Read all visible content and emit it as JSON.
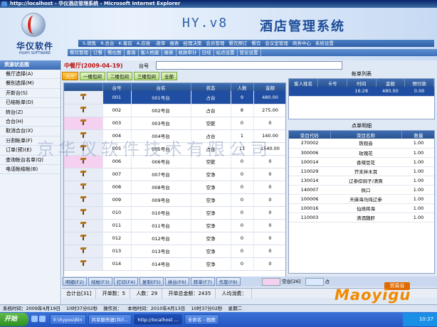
{
  "window_title": "http://localhost - 华仪酒店管理系统 - Microsoft Internet Explorer",
  "header": {
    "logo_cn": "华仪软件",
    "logo_en": "HUAYI SOFTWARE",
    "version": "HY.v8",
    "app_title": "酒店管理系统"
  },
  "menu_primary": [
    "S.销售",
    "R.总台",
    "K.客房",
    "A.应收",
    ".夜审",
    "报表",
    "经理决策",
    "会员管理",
    "餐饮预订",
    "餐饮",
    "会议室管理",
    "商务中心",
    "系统设置"
  ],
  "menu_secondary": [
    "餐饮管理",
    "订餐",
    "餐位图",
    "查询",
    "客人档案",
    "报表",
    "收款审计",
    "日结",
    "站点设置",
    "营业设置"
  ],
  "sidebar": {
    "title": "资源状态图",
    "items": [
      "餐厅选择(A)",
      "餐别选择(M)",
      "开新台(S)",
      "已结帐单(D)",
      "转台(Z)",
      "合台(H)",
      "取消合台(X)",
      "分割帐单(F)",
      "订单(预)(E)",
      "查询帐台名单(Q)",
      "电话帐结帐(B)"
    ]
  },
  "hall": {
    "label": "中餐厅(2009-04-19)",
    "table_label": "台号",
    "table_value": ""
  },
  "area_buttons": [
    "大厅",
    "一楼包间",
    "二楼包间",
    "三楼包间",
    "全部"
  ],
  "grid": {
    "headers": [
      "",
      "台号",
      "台名",
      "状态",
      "人数",
      "金额"
    ],
    "rows": [
      {
        "no": "001",
        "name": "001号台",
        "status": "占台",
        "people": "9",
        "amount": "480.00",
        "pink": false,
        "selected": true
      },
      {
        "no": "002",
        "name": "002号台",
        "status": "占台",
        "people": "8",
        "amount": "275.00",
        "pink": false,
        "selected": false
      },
      {
        "no": "003",
        "name": "003号台",
        "status": "空脏",
        "people": "0",
        "amount": "0",
        "pink": true,
        "selected": false
      },
      {
        "no": "004",
        "name": "004号台",
        "status": "占台",
        "people": "1",
        "amount": "140.00",
        "pink": false,
        "selected": false
      },
      {
        "no": "005",
        "name": "005号台",
        "status": "占台",
        "people": "11",
        "amount": "1540.00",
        "pink": false,
        "selected": false
      },
      {
        "no": "006",
        "name": "006号台",
        "status": "空脏",
        "people": "0",
        "amount": "0",
        "pink": true,
        "selected": false
      },
      {
        "no": "007",
        "name": "007号台",
        "status": "空净",
        "people": "0",
        "amount": "0",
        "pink": false,
        "selected": false
      },
      {
        "no": "008",
        "name": "008号台",
        "status": "空净",
        "people": "0",
        "amount": "0",
        "pink": false,
        "selected": false
      },
      {
        "no": "009",
        "name": "009号台",
        "status": "空净",
        "people": "0",
        "amount": "0",
        "pink": false,
        "selected": false
      },
      {
        "no": "010",
        "name": "010号台",
        "status": "空净",
        "people": "0",
        "amount": "0",
        "pink": false,
        "selected": false
      },
      {
        "no": "011",
        "name": "011号台",
        "status": "空净",
        "people": "0",
        "amount": "0",
        "pink": false,
        "selected": false
      },
      {
        "no": "012",
        "name": "012号台",
        "status": "空净",
        "people": "0",
        "amount": "0",
        "pink": false,
        "selected": false
      },
      {
        "no": "013",
        "name": "013号台",
        "status": "空净",
        "people": "0",
        "amount": "0",
        "pink": false,
        "selected": false
      },
      {
        "no": "014",
        "name": "014号台",
        "status": "空净",
        "people": "0",
        "amount": "0",
        "pink": false,
        "selected": false
      }
    ]
  },
  "bill_list": {
    "title": "帐单列表",
    "headers": [
      "客人姓名",
      "卡号",
      "时间",
      "金额",
      "预付款"
    ],
    "rows": [
      {
        "guest": "",
        "card": "",
        "time": "16:28",
        "amount": "480.00",
        "prepay": "0.00"
      }
    ]
  },
  "order_detail": {
    "title": "点单明细",
    "headers": [
      "菜目代码",
      "菜目名称",
      "数量"
    ],
    "rows": [
      {
        "code": "270002",
        "name": "铁观音",
        "qty": "1.00"
      },
      {
        "code": "300006",
        "name": "玫瑰花",
        "qty": "1.00"
      },
      {
        "code": "100014",
        "name": "香辣豆花",
        "qty": "1.00"
      },
      {
        "code": "110029",
        "name": "芥末拌木耳",
        "qty": "1.00"
      },
      {
        "code": "130014",
        "name": "辽参扣焖子/清爽",
        "qty": "1.00"
      },
      {
        "code": "140007",
        "name": "佩口",
        "qty": "1.00"
      },
      {
        "code": "100006",
        "name": "天麻海马炖辽参",
        "qty": "1.00"
      },
      {
        "code": "100016",
        "name": "仙焙蒋海",
        "qty": "1.00"
      },
      {
        "code": "110003",
        "name": "清酒魏肝",
        "qty": "1.00"
      }
    ]
  },
  "function_buttons": [
    "明细(F2)",
    "结帐(F3)",
    "打印(F4)",
    "复制(F5)",
    "拼台(F6)",
    "转单(F7)",
    "作废(F8)"
  ],
  "legend": {
    "pink_label": "空台[26]",
    "label2": "占"
  },
  "summary": {
    "count": "合计台[31]",
    "tables": "开单数：5",
    "people": "人数：29",
    "total": "开单总金额：2435",
    "avg": "人均消费："
  },
  "watermark": "京华仪软件技术有限公司",
  "brand": {
    "cn": "贸易谷",
    "en": "Maoyigu"
  },
  "sys_status": [
    "系统时间：2009年4月19日",
    "10时37分02秒",
    "操作员：",
    "本地时间：2010年4月13日",
    "10时37分02秒",
    "星期二"
  ],
  "taskbar": {
    "start_label": "开始",
    "buttons": [
      "E:\\hypos\\Bin",
      "共享服务器(共0...",
      "http://localhost ...",
      "未命名 - 画图"
    ],
    "clock": "10:37"
  },
  "colors": {
    "accent": "#2a538f",
    "selected_row": "#1f4ea3",
    "pink_status": "#f5d0f0",
    "active_tab": "#f0a000"
  }
}
